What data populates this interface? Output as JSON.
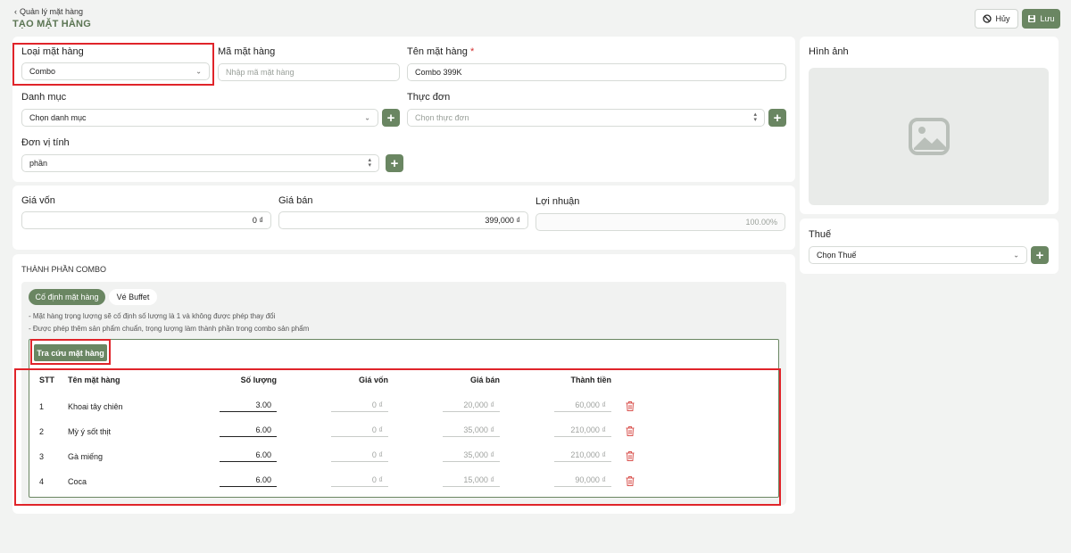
{
  "header": {
    "breadcrumb": "Quản lý mặt hàng",
    "title": "TẠO MẶT HÀNG",
    "cancel_label": "Hủy",
    "save_label": "Lưu"
  },
  "form": {
    "item_type": {
      "label": "Loại mặt hàng",
      "value": "Combo"
    },
    "item_code": {
      "label": "Mã mặt hàng",
      "placeholder": "Nhập mã mặt hàng"
    },
    "item_name": {
      "label": "Tên mặt hàng",
      "required_mark": "*",
      "value": "Combo 399K"
    },
    "category": {
      "label": "Danh mục",
      "placeholder": "Chọn danh mục"
    },
    "menu": {
      "label": "Thực đơn",
      "placeholder": "Chọn thực đơn"
    },
    "unit": {
      "label": "Đơn vị tính",
      "value": "phần"
    }
  },
  "pricing": {
    "cost": {
      "label": "Giá vốn",
      "value": "0 ₫"
    },
    "price": {
      "label": "Giá bán",
      "value": "399,000 ₫"
    },
    "profit": {
      "label": "Lợi nhuận",
      "value": "100.00%"
    }
  },
  "combo": {
    "section_title": "THÀNH PHẦN COMBO",
    "tabs": [
      {
        "label": "Cố định mặt hàng"
      },
      {
        "label": "Vé Buffet"
      }
    ],
    "notes": [
      "- Mặt hàng trọng lượng sẽ cố định số lượng là 1 và không được phép thay đổi",
      "- Được phép thêm sản phẩm chuẩn, trọng lượng làm thành phần trong combo sản phẩm"
    ],
    "lookup_button": "Tra cứu mặt hàng",
    "columns": [
      "STT",
      "Tên mặt hàng",
      "Số lượng",
      "Giá vốn",
      "Giá bán",
      "Thành tiền"
    ],
    "rows": [
      {
        "stt": "1",
        "name": "Khoai tây chiên",
        "qty": "3.00",
        "cost": "0 ₫",
        "price": "20,000 ₫",
        "total": "60,000 ₫"
      },
      {
        "stt": "2",
        "name": "Mỳ ý sốt thịt",
        "qty": "6.00",
        "cost": "0 ₫",
        "price": "35,000 ₫",
        "total": "210,000 ₫"
      },
      {
        "stt": "3",
        "name": "Gà miếng",
        "qty": "6.00",
        "cost": "0 ₫",
        "price": "35,000 ₫",
        "total": "210,000 ₫"
      },
      {
        "stt": "4",
        "name": "Coca",
        "qty": "6.00",
        "cost": "0 ₫",
        "price": "15,000 ₫",
        "total": "90,000 ₫"
      }
    ]
  },
  "side": {
    "image_label": "Hình ảnh",
    "tax": {
      "label": "Thuế",
      "placeholder": "Chọn Thuế"
    }
  },
  "colors": {
    "accent": "#6a8662",
    "highlight": "#e0242a",
    "delete": "#d9534f"
  }
}
